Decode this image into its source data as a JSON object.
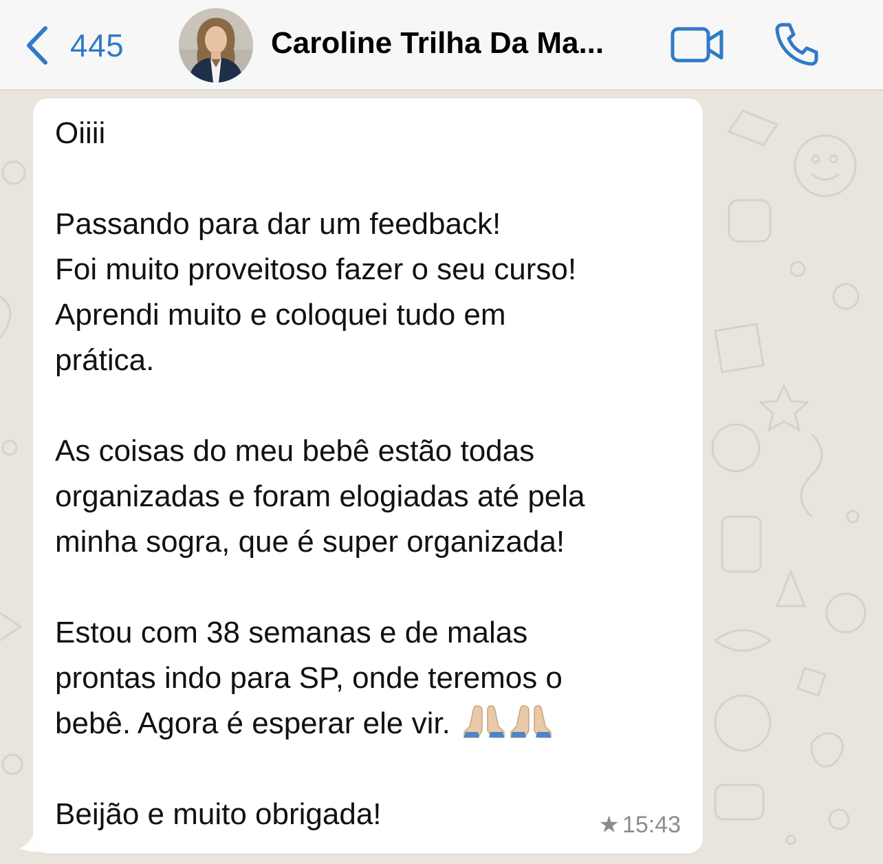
{
  "header": {
    "back_count": "445",
    "contact_name": "Caroline Trilha Da Ma...",
    "icons": {
      "back": "chevron-left-icon",
      "video": "video-camera-icon",
      "call": "phone-icon"
    },
    "accent_color": "#2f7ac7"
  },
  "message": {
    "lines_block_1": "Oiiii",
    "lines_block_2": "Passando para dar um feedback!\nFoi muito proveitoso fazer o seu curso!\nAprendi muito e coloquei tudo em\nprática.",
    "lines_block_3": "As coisas do meu bebê estão todas\norganizadas e foram elogiadas até pela\nminha sogra, que é super organizada!",
    "lines_block_4": "Estou com 38 semanas e de malas\nprontas indo para SP, onde teremos o\nbebê. Agora é esperar ele vir.",
    "emoji": "folded-hands-emoji",
    "lines_block_5": "Beijão e muito obrigada!",
    "time": "15:43",
    "starred": true
  }
}
